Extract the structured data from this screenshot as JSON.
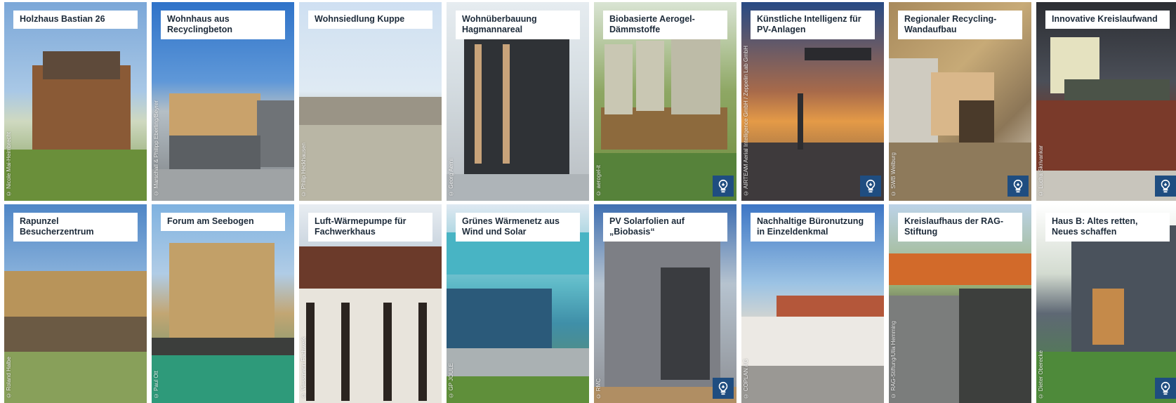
{
  "cards": [
    {
      "title": "Holzhaus Bastian 26",
      "credit": "© Nicole Mai-Heimbrecht",
      "badge": false
    },
    {
      "title": "Wohnhaus aus Recyclingbeton",
      "credit": "© Marschall & Philipp Eberling/Beyrer",
      "badge": false
    },
    {
      "title": "Wohnsiedlung Kuppe",
      "credit": "© Philip Heckhausen",
      "badge": false
    },
    {
      "title": "Wohnüberbauung Hagmannareal",
      "credit": "© Georg Aerni",
      "badge": false
    },
    {
      "title": "Biobasierte Aerogel-Dämmstoffe",
      "credit": "© aerogel-it",
      "badge": true
    },
    {
      "title": "Künstliche Intelligenz für PV-Anlagen",
      "credit": "© AIRTEAM Aerial Intelligence GmbH / Zeppelin Lab GmbH",
      "badge": true
    },
    {
      "title": "Regionaler Recycling-Wandaufbau",
      "credit": "© SWB Weilburg",
      "badge": true
    },
    {
      "title": "Innovative Kreislaufwand",
      "credit": "© Lucha Skrivankar",
      "badge": true
    },
    {
      "title": "Rapunzel Besucherzentrum",
      "credit": "© Roland Halbe",
      "badge": false
    },
    {
      "title": "Forum am Seebogen",
      "credit": "© Paul Ott",
      "badge": false
    },
    {
      "title": "Luft-Wärmepumpe für Fachwerkhaus",
      "credit": "© Viessmann Fachwerk",
      "badge": false
    },
    {
      "title": "Grünes Wärmenetz aus Wind und Solar",
      "credit": "© GP JOULE",
      "badge": false
    },
    {
      "title": "PV Solarfolien auf „Biobasis“",
      "credit": "© RMC",
      "badge": true
    },
    {
      "title": "Nachhaltige Büronutzung in Einzeldenkmal",
      "credit": "© COPLAN AG",
      "badge": false
    },
    {
      "title": "Kreislaufhaus der RAG-Stiftung",
      "credit": "© RAG-Stiftung/Ulla Hemming",
      "badge": false
    },
    {
      "title": "Haus B: Altes retten, Neues schaffen",
      "credit": "© Dieter Oberecke",
      "badge": true
    }
  ],
  "colors": {
    "badge": "#1f4d80",
    "title_text": "#1d2b3a",
    "title_bg": "#ffffff"
  },
  "badge_icon": "lightbulb-icon"
}
